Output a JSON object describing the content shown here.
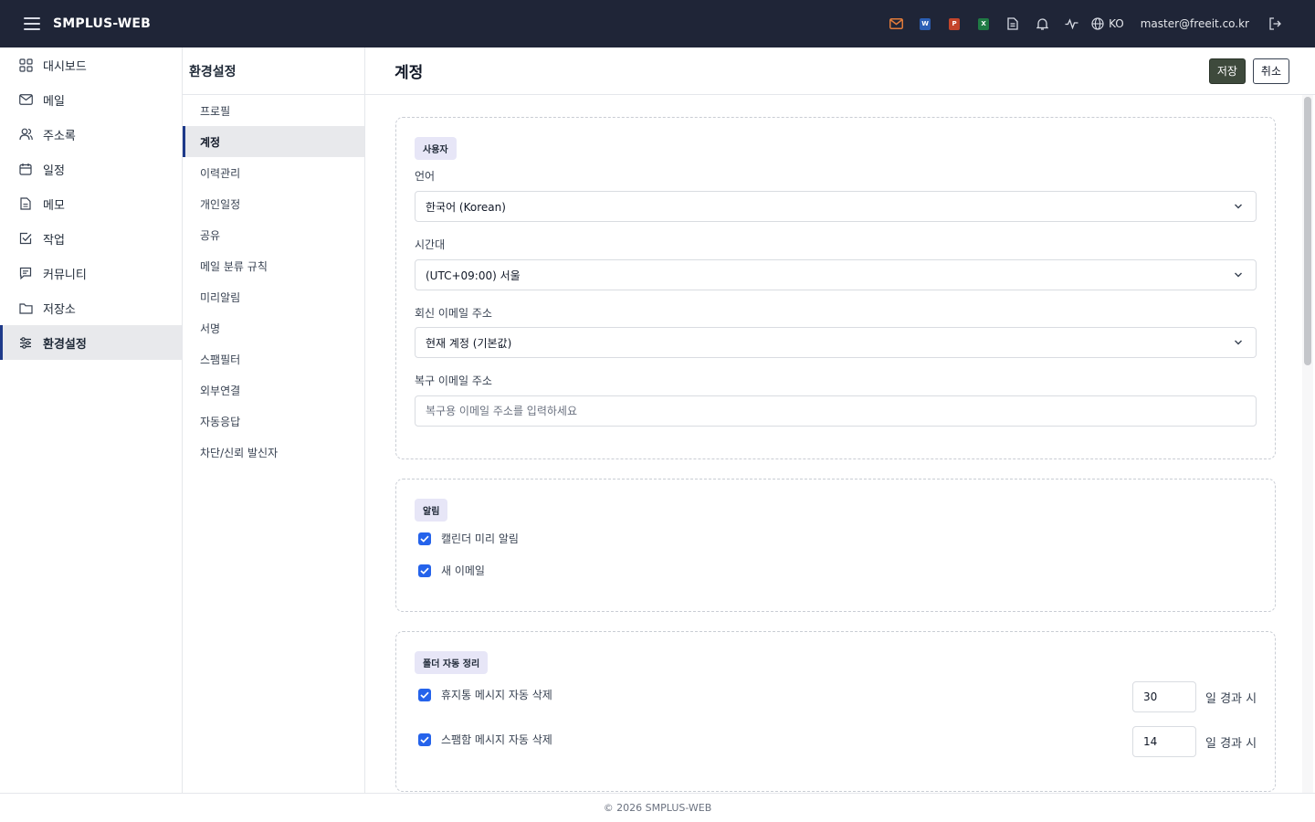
{
  "app": {
    "brand": "SMPLUS-WEB"
  },
  "topbar": {
    "icons": [
      "mail-icon",
      "word-icon",
      "powerpoint-icon",
      "excel-icon",
      "document-icon",
      "bell-icon",
      "activity-icon",
      "globe-icon",
      "logout-icon"
    ],
    "badges": {
      "word": "W",
      "powerpoint": "P",
      "excel": "X"
    },
    "colors": {
      "mail": "#e07a3a",
      "word": "#2b5fb5",
      "powerpoint": "#c4452b",
      "excel": "#1f7a44",
      "bar": "#1f2537"
    },
    "language": "KO",
    "user_email": "master@freeit.co.kr"
  },
  "sidebar": {
    "items": [
      {
        "label": "대시보드",
        "icon": "grid-icon"
      },
      {
        "label": "메일",
        "icon": "mail-icon"
      },
      {
        "label": "주소록",
        "icon": "users-icon"
      },
      {
        "label": "일정",
        "icon": "calendar-icon"
      },
      {
        "label": "메모",
        "icon": "note-icon"
      },
      {
        "label": "작업",
        "icon": "check-square-icon"
      },
      {
        "label": "커뮤니티",
        "icon": "chat-icon"
      },
      {
        "label": "저장소",
        "icon": "folder-icon"
      },
      {
        "label": "환경설정",
        "icon": "sliders-icon",
        "active": true
      }
    ]
  },
  "submenu": {
    "title": "환경설정",
    "items": [
      "프로필",
      "계정",
      "이력관리",
      "개인일정",
      "공유",
      "메일 분류 규칙",
      "미리알림",
      "서명",
      "스팸필터",
      "외부연결",
      "자동응답",
      "차단/신뢰 발신자"
    ],
    "active_index": 1
  },
  "main": {
    "title": "계정",
    "save_label": "저장",
    "cancel_label": "취소"
  },
  "user_section": {
    "badge": "사용자",
    "language_label": "언어",
    "language_value": "한국어 (Korean)",
    "timezone_label": "시간대",
    "timezone_value": "(UTC+09:00) 서울",
    "reply_email_label": "회신 이메일 주소",
    "reply_email_value": "현재 계정 (기본값)",
    "recovery_email_label": "복구 이메일 주소",
    "recovery_email_placeholder": "복구용 이메일 주소를 입력하세요"
  },
  "notification_section": {
    "badge": "알림",
    "items": [
      {
        "label": "캘린더 미리 알림",
        "checked": true
      },
      {
        "label": "새 이메일",
        "checked": true
      }
    ]
  },
  "folder_cleanup_section": {
    "badge": "폴더 자동 정리",
    "items": [
      {
        "label": "휴지통 메시지 자동 삭제",
        "checked": true,
        "days": "30",
        "unit": "일 경과 시"
      },
      {
        "label": "스팸함 메시지 자동 삭제",
        "checked": true,
        "days": "14",
        "unit": "일 경과 시"
      }
    ]
  },
  "footer": {
    "text": "© 2026 SMPLUS-WEB"
  }
}
